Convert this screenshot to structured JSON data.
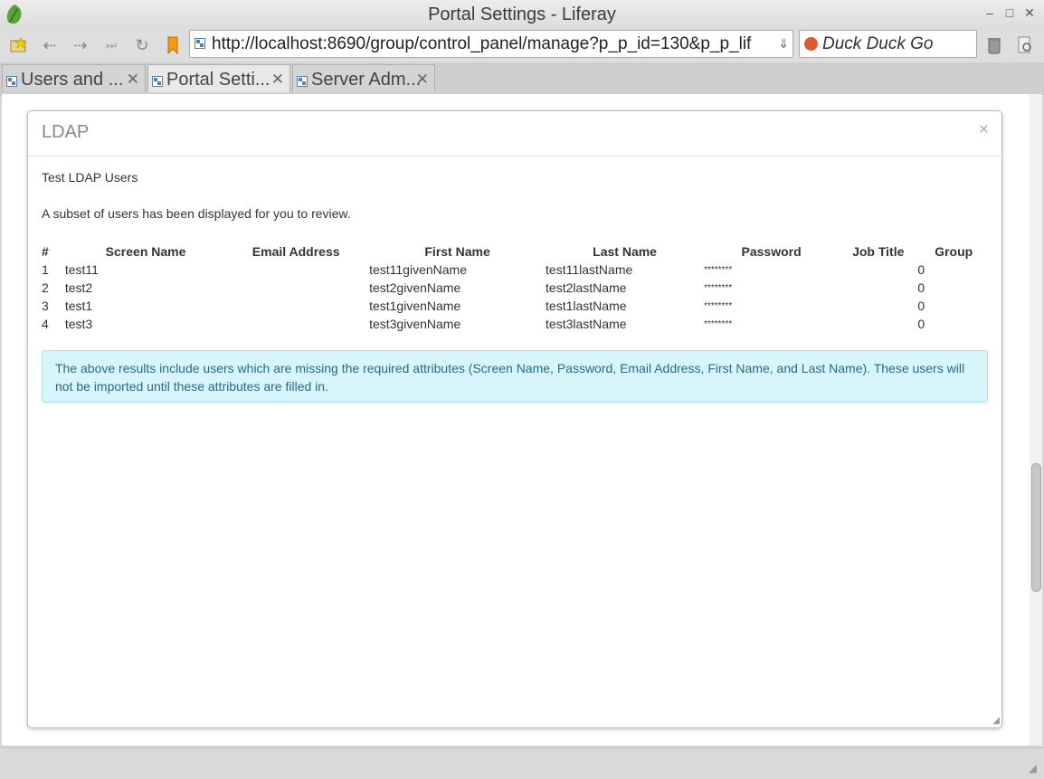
{
  "window": {
    "title": "Portal Settings - Liferay"
  },
  "navigation": {
    "url": "http://localhost:8690/group/control_panel/manage?p_p_id=130&p_p_lif",
    "search_engine": "Duck Duck Go"
  },
  "tabs": [
    {
      "label": "Users and ..."
    },
    {
      "label": "Portal Setti..."
    },
    {
      "label": "Server Adm..."
    }
  ],
  "dialog": {
    "title": "LDAP",
    "close_glyph": "×",
    "subtitle": "Test LDAP Users",
    "intro": "A subset of users has been displayed for you to review.",
    "table": {
      "headers": [
        "#",
        "Screen Name",
        "Email Address",
        "First Name",
        "Last Name",
        "Password",
        "Job Title",
        "Group"
      ],
      "rows": [
        {
          "num": "1",
          "screen_name": "test11",
          "email": "",
          "first_name": "test11givenName",
          "last_name": "test11lastName",
          "password": "********",
          "job_title": "",
          "group": "0"
        },
        {
          "num": "2",
          "screen_name": "test2",
          "email": "",
          "first_name": "test2givenName",
          "last_name": "test2lastName",
          "password": "********",
          "job_title": "",
          "group": "0"
        },
        {
          "num": "3",
          "screen_name": "test1",
          "email": "",
          "first_name": "test1givenName",
          "last_name": "test1lastName",
          "password": "********",
          "job_title": "",
          "group": "0"
        },
        {
          "num": "4",
          "screen_name": "test3",
          "email": "",
          "first_name": "test3givenName",
          "last_name": "test3lastName",
          "password": "********",
          "job_title": "",
          "group": "0"
        }
      ]
    },
    "alert": "The above results include users which are missing the required attributes (Screen Name, Password, Email Address, First Name, and Last Name). These users will not be imported until these attributes are filled in."
  },
  "colors": {
    "alert_bg": "#d9f5fc",
    "alert_text": "#236c86",
    "ddg_logo": "#de5833"
  }
}
